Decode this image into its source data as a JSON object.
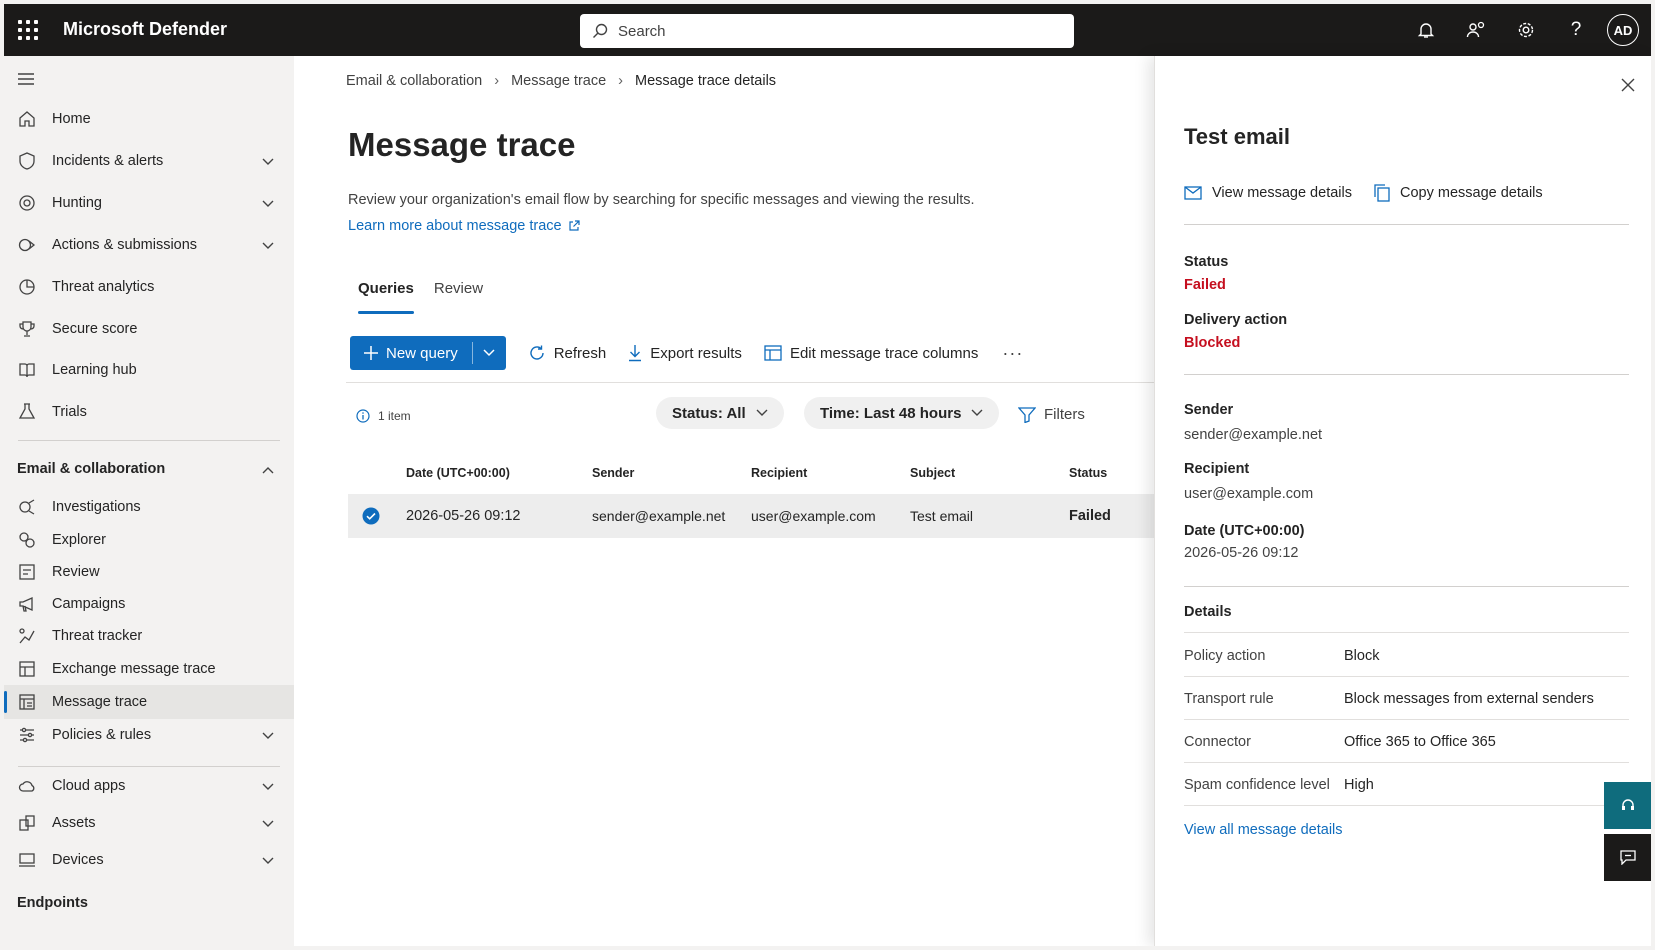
{
  "app": {
    "title": "Microsoft Defender",
    "avatar_initials": "AD"
  },
  "search": {
    "placeholder": "Search"
  },
  "nav": {
    "items_top": [
      {
        "label": "Home",
        "icon": "home-icon",
        "chevron": false
      },
      {
        "label": "Incidents & alerts",
        "icon": "shield-icon",
        "chevron": true
      },
      {
        "label": "Hunting",
        "icon": "target-icon",
        "chevron": true
      },
      {
        "label": "Actions & submissions",
        "icon": "actions-icon",
        "chevron": true
      },
      {
        "label": "Threat analytics",
        "icon": "analytics-icon",
        "chevron": false
      },
      {
        "label": "Secure score",
        "icon": "trophy-icon",
        "chevron": false
      },
      {
        "label": "Learning hub",
        "icon": "book-icon",
        "chevron": false
      },
      {
        "label": "Trials",
        "icon": "trials-icon",
        "chevron": false
      }
    ],
    "section_title": "Email & collaboration",
    "items_email": [
      {
        "label": "Investigations",
        "icon": "investigations-icon"
      },
      {
        "label": "Explorer",
        "icon": "explorer-icon"
      },
      {
        "label": "Review",
        "icon": "review-icon"
      },
      {
        "label": "Campaigns",
        "icon": "megaphone-icon"
      },
      {
        "label": "Threat tracker",
        "icon": "tracker-icon"
      },
      {
        "label": "Exchange message trace",
        "icon": "exchange-trace-icon"
      },
      {
        "label": "Message trace",
        "icon": "message-trace-icon"
      },
      {
        "label": "Policies & rules",
        "icon": "policies-icon"
      }
    ],
    "items_bottom": [
      {
        "label": "Cloud apps",
        "icon": "cloud-icon"
      },
      {
        "label": "Assets",
        "icon": "assets-icon"
      },
      {
        "label": "Devices",
        "icon": "device-icon"
      }
    ],
    "cut_off_label": "Endpoints"
  },
  "main": {
    "breadcrumb": [
      "Email & collaboration",
      "Message trace",
      "Message trace details"
    ],
    "title": "Message trace",
    "description": "Review your organization's email flow by searching for specific messages and viewing the results.",
    "learn_more": "Learn more about message trace",
    "tabs": [
      "Queries",
      "Review"
    ],
    "toolbar": {
      "new_query": "New query",
      "refresh": "Refresh",
      "export": "Export results",
      "edit_columns": "Edit message trace columns",
      "more": "···"
    },
    "item_count": "1 item",
    "status_filter": "Status: All",
    "time_filter": "Time: Last 48 hours",
    "filters": "Filters",
    "columns": [
      "Date (UTC+00:00)",
      "Sender",
      "Recipient",
      "Subject",
      "Status"
    ],
    "rows": [
      {
        "date": "2026-05-26 09:12",
        "sender": "sender@example.net",
        "recipient": "user@example.com",
        "subject": "Test email",
        "status": "Failed"
      }
    ]
  },
  "panel": {
    "title": "Test email",
    "view_details": "View message details",
    "copy_details": "Copy message details",
    "status_label": "Status",
    "status_value": "Failed",
    "delivery_label": "Delivery action",
    "delivery_value": "Blocked",
    "sender_label": "Sender",
    "sender_value": "sender@example.net",
    "recipient_label": "Recipient",
    "recipient_value": "user@example.com",
    "date_label": "Date (UTC+00:00)",
    "date_value": "2026-05-26 09:12",
    "details_label": "Details",
    "details": [
      {
        "key": "Policy action",
        "value": "Block"
      },
      {
        "key": "Transport rule",
        "value": "Block messages from external senders"
      },
      {
        "key": "Connector",
        "value": "Office 365 to Office 365"
      },
      {
        "key": "Spam confidence level",
        "value": "High"
      }
    ],
    "view_all": "View all message details"
  },
  "colors": {
    "accent": "#0f6cbd",
    "failed": "#c50f1f",
    "topbar": "#1b1a19"
  }
}
